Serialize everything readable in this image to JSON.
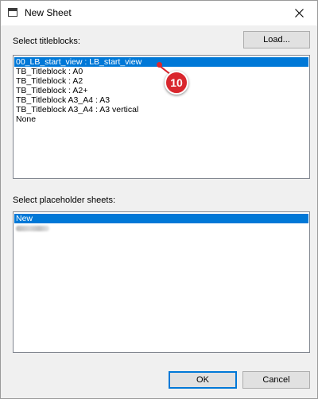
{
  "window": {
    "title": "New Sheet",
    "close_icon": "close-icon",
    "app_icon": "window-icon"
  },
  "titleblocks": {
    "label": "Select titleblocks:",
    "load_button": "Load...",
    "items": [
      "00_LB_start_view : LB_start_view",
      "TB_Titleblock : A0",
      "TB_Titleblock : A2",
      "TB_Titleblock : A2+",
      "TB_Titleblock A3_A4 : A3",
      "TB_Titleblock A3_A4 : A3 vertical",
      "None"
    ],
    "selected_index": 0
  },
  "placeholders": {
    "label": "Select placeholder sheets:",
    "items": [
      "New"
    ],
    "selected_index": 0
  },
  "callout": {
    "number": "10",
    "color": "#d9272e"
  },
  "footer": {
    "ok_label": "OK",
    "cancel_label": "Cancel"
  },
  "colors": {
    "selection": "#0078d7",
    "dialog_bg": "#f0f0f0"
  }
}
